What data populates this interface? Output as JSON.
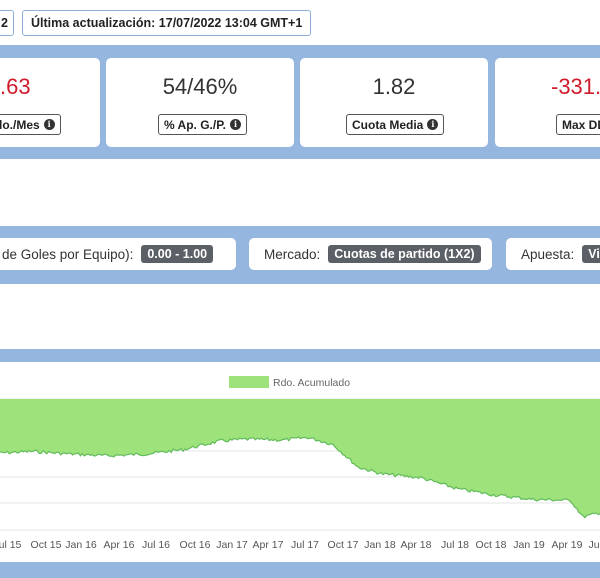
{
  "header": {
    "left_fragment": "2",
    "last_update": "Última actualización: 17/07/2022 13:04 GMT+1"
  },
  "stats": [
    {
      "value": ".63",
      "label": "do./Mes",
      "negative": true
    },
    {
      "value": "54/46%",
      "label": "% Ap. G./P.",
      "negative": false
    },
    {
      "value": "1.82",
      "label": "Cuota Media",
      "negative": false
    },
    {
      "value": "-331.",
      "label": "Max DD",
      "negative": true
    }
  ],
  "filters": {
    "goals_label": "de Goles por Equipo):",
    "goals_value": "0.00 - 1.00",
    "market_label": "Mercado:",
    "market_value": "Cuotas de partido (1X2)",
    "bet_label": "Apuesta:",
    "bet_value": "Vi"
  },
  "chart_data": {
    "type": "area",
    "legend": [
      "Rdo. Acumulado"
    ],
    "color": "#9de27a",
    "line_color": "#62bb5c",
    "x_ticks": [
      "ul 15",
      "Oct 15",
      "Jan 16",
      "Apr 16",
      "Jul 16",
      "Oct 16",
      "Jan 17",
      "Apr 17",
      "Jul 17",
      "Oct 17",
      "Jan 18",
      "Apr 18",
      "Jul 18",
      "Oct 18",
      "Jan 19",
      "Apr 19",
      "Ju"
    ],
    "series": [
      {
        "name": "Rdo. Acumulado",
        "x": [
          "Jun 15",
          "Sep 15",
          "Dec 15",
          "Mar 16",
          "Jun 16",
          "Sep 16",
          "Dec 16",
          "Feb 17",
          "May 17",
          "Jul 17",
          "Sep 17",
          "Nov 17",
          "Jan 18",
          "Apr 18",
          "Jul 18",
          "Oct 18",
          "Jan 19",
          "Apr 19",
          "May 19",
          "Jul 19"
        ],
        "values": [
          -62,
          -60,
          -63,
          -65,
          -63,
          -58,
          -48,
          -46,
          -47,
          -44,
          -52,
          -78,
          -86,
          -90,
          -103,
          -110,
          -115,
          -116,
          -135,
          -128
        ]
      }
    ],
    "ylim": [
      -150,
      0
    ]
  }
}
